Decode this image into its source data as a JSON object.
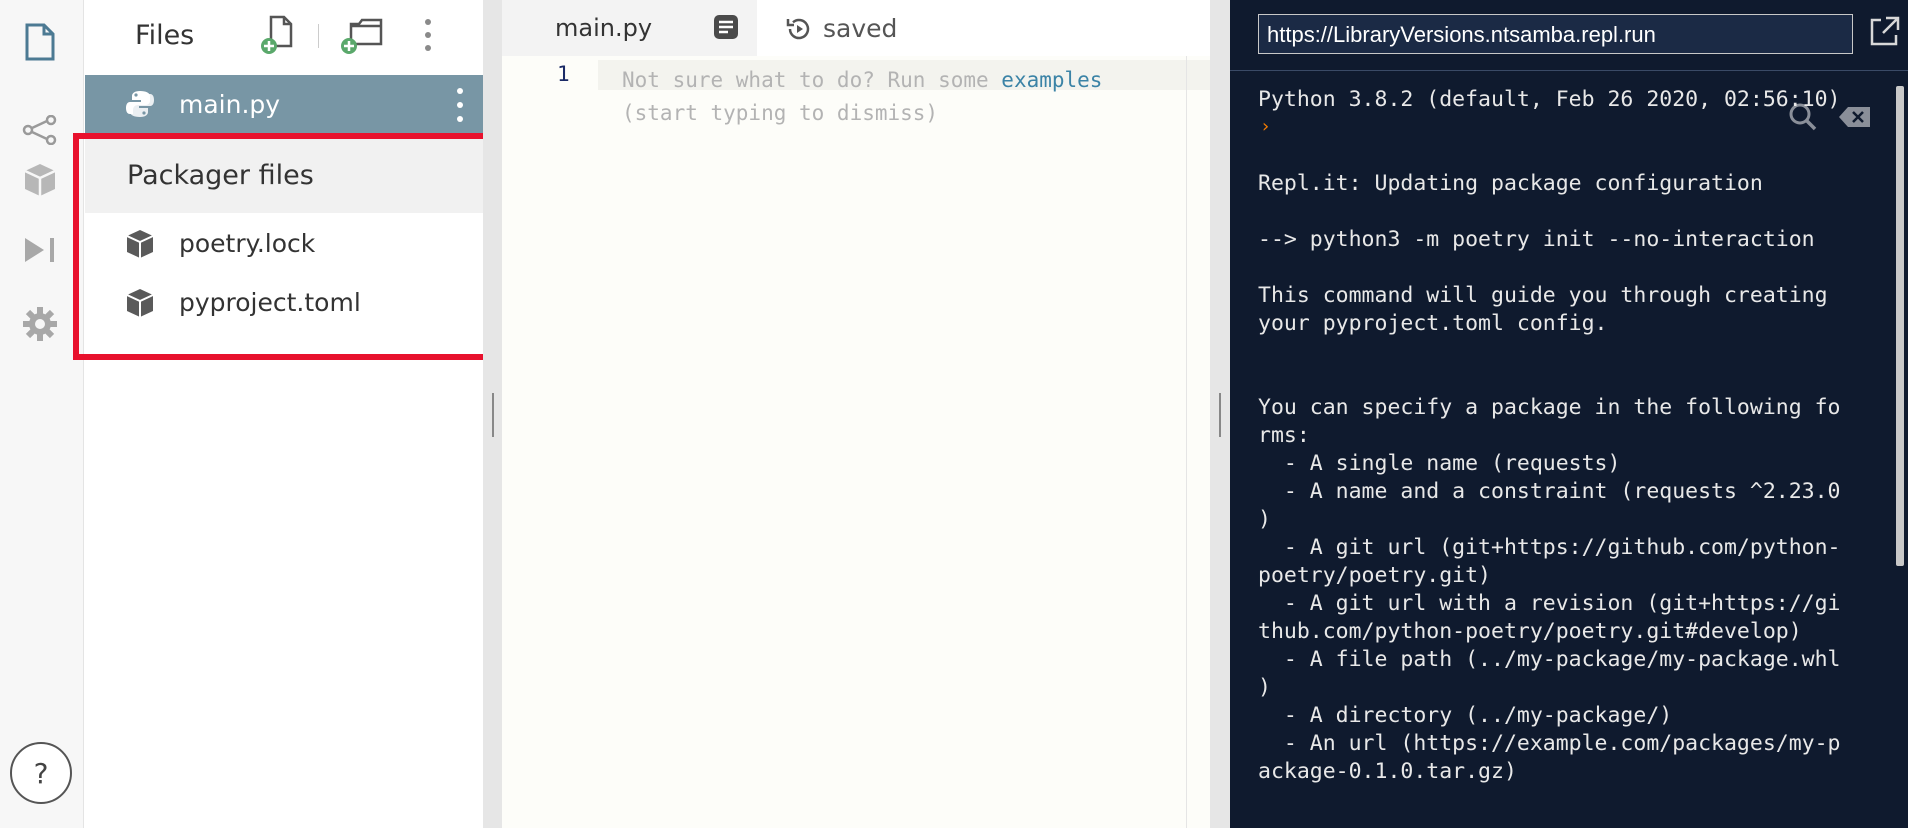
{
  "rail": {
    "icons": [
      "file-icon",
      "share-icon",
      "package-icon",
      "run-icon",
      "settings-icon"
    ],
    "help_label": "?"
  },
  "files": {
    "title": "Files",
    "items": [
      {
        "name": "main.py",
        "icon": "python-icon",
        "selected": true
      }
    ],
    "packager": {
      "title": "Packager files",
      "items": [
        {
          "name": "poetry.lock",
          "icon": "package-icon"
        },
        {
          "name": "pyproject.toml",
          "icon": "package-icon"
        }
      ]
    }
  },
  "editor": {
    "tab_label": "main.py",
    "status": "saved",
    "line_number": "1",
    "placeholder_line1_prefix": "Not sure what to do? Run some ",
    "placeholder_link": "examples",
    "placeholder_line2": "(start typing to dismiss)"
  },
  "console": {
    "url": "https://LibraryVersions.ntsamba.repl.run",
    "prompt_symbol": "›",
    "output": "Python 3.8.2 (default, Feb 26 2020, 02:56:10)\n\n\nRepl.it: Updating package configuration\n\n--> python3 -m poetry init --no-interaction\n\nThis command will guide you through creating\nyour pyproject.toml config.\n\n\nYou can specify a package in the following fo\nrms:\n  - A single name (requests)\n  - A name and a constraint (requests ^2.23.0\n)\n  - A git url (git+https://github.com/python-\npoetry/poetry.git)\n  - A git url with a revision (git+https://gi\nthub.com/python-poetry/poetry.git#develop)\n  - A file path (../my-package/my-package.whl\n)\n  - A directory (../my-package/)\n  - An url (https://example.com/packages/my-p\nackage-0.1.0.tar.gz)"
  },
  "colors": {
    "selected_row": "#7896a5",
    "highlight_box": "#e8112d",
    "console_bg": "#0f1a2e",
    "link": "#3b83a6",
    "prompt": "#f57c00",
    "add_badge": "#5aa86b"
  }
}
